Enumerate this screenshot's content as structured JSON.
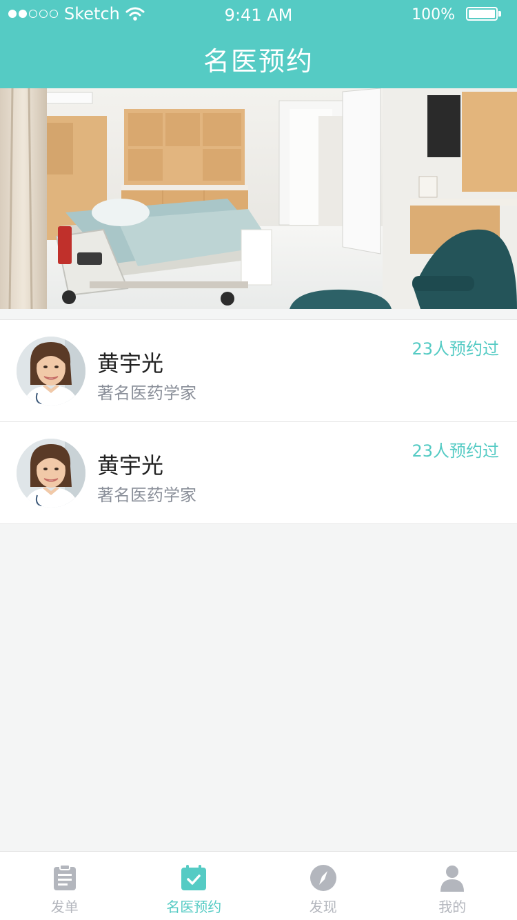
{
  "status_bar": {
    "carrier": "Sketch",
    "time": "9:41 AM",
    "battery": "100%"
  },
  "nav": {
    "title": "名医预约"
  },
  "doctors": [
    {
      "name": "黄宇光",
      "title": "著名医药学家",
      "booked": "23人预约过"
    },
    {
      "name": "黄宇光",
      "title": "著名医药学家",
      "booked": "23人预约过"
    }
  ],
  "tabs": [
    {
      "label": "发单",
      "icon": "clipboard-icon",
      "active": false
    },
    {
      "label": "名医预约",
      "icon": "calendar-check-icon",
      "active": true
    },
    {
      "label": "发现",
      "icon": "compass-icon",
      "active": false
    },
    {
      "label": "我的",
      "icon": "user-icon",
      "active": false
    }
  ],
  "colors": {
    "accent": "#55cbc4",
    "inactive": "#b3b6bd",
    "background": "#f4f5f5"
  }
}
